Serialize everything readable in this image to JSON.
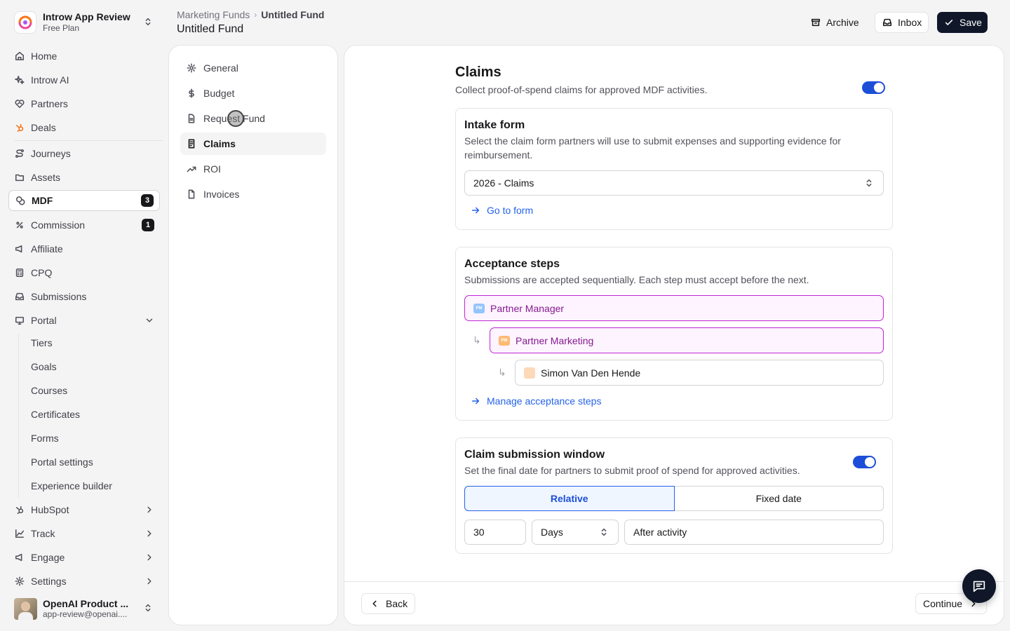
{
  "workspace": {
    "name": "Introw App Review",
    "plan": "Free Plan"
  },
  "sidebar": {
    "items": [
      {
        "label": "Home",
        "icon": "home-icon"
      },
      {
        "label": "Introw AI",
        "icon": "sparkle-icon"
      },
      {
        "label": "Partners",
        "icon": "handshake-icon"
      },
      {
        "label": "Deals",
        "icon": "hubspot-icon"
      },
      {
        "label": "Journeys",
        "icon": "route-icon"
      },
      {
        "label": "Assets",
        "icon": "folder-icon"
      },
      {
        "label": "MDF",
        "icon": "coins-icon",
        "badge": "3"
      },
      {
        "label": "Commission",
        "icon": "percent-icon",
        "badge": "1"
      },
      {
        "label": "Affiliate",
        "icon": "megaphone-icon"
      },
      {
        "label": "CPQ",
        "icon": "calculator-icon"
      },
      {
        "label": "Submissions",
        "icon": "inbox-icon"
      },
      {
        "label": "Portal",
        "icon": "monitor-icon"
      }
    ],
    "portal_sub": [
      "Tiers",
      "Goals",
      "Courses",
      "Certificates",
      "Forms",
      "Portal settings",
      "Experience builder"
    ],
    "bottom": [
      {
        "label": "HubSpot",
        "icon": "hubspot-icon"
      },
      {
        "label": "Track",
        "icon": "chart-icon"
      },
      {
        "label": "Engage",
        "icon": "megaphone-icon"
      },
      {
        "label": "Settings",
        "icon": "gear-icon"
      }
    ]
  },
  "user": {
    "name": "OpenAI Product ...",
    "email": "app-review@openai...."
  },
  "header": {
    "breadcrumb_parent": "Marketing Funds",
    "breadcrumb_current": "Untitled Fund",
    "title": "Untitled Fund",
    "archive": "Archive",
    "inbox": "Inbox",
    "save": "Save"
  },
  "fund_nav": [
    "General",
    "Budget",
    "Request Fund",
    "Claims",
    "ROI",
    "Invoices"
  ],
  "claims": {
    "title": "Claims",
    "description": "Collect proof-of-spend claims for approved MDF activities.",
    "enabled": true,
    "intake": {
      "title": "Intake form",
      "description": "Select the claim form partners will use to submit expenses and supporting evidence for reimbursement.",
      "selected_form": "2026 - Claims",
      "link": "Go to form"
    },
    "acceptance": {
      "title": "Acceptance steps",
      "description": "Submissions are accepted sequentially. Each step must accept before the next.",
      "steps": [
        {
          "label": "Partner Manager",
          "chip": "PM",
          "chip_color": "#93c5fd"
        },
        {
          "label": "Partner Marketing",
          "chip": "PM",
          "chip_color": "#fdba74"
        },
        {
          "label": "Simon Van Den Hende"
        }
      ],
      "link": "Manage acceptance steps"
    },
    "window": {
      "title": "Claim submission window",
      "description": "Set the final date for partners to submit proof of spend for approved activities.",
      "enabled": true,
      "mode_relative": "Relative",
      "mode_fixed": "Fixed date",
      "amount": "30",
      "unit": "Days",
      "relation": "After activity"
    }
  },
  "footer": {
    "back": "Back",
    "continue": "Continue"
  },
  "colors": {
    "accent": "#1d4ed8",
    "dark": "#0f1729",
    "step_border": "#c026d3"
  }
}
